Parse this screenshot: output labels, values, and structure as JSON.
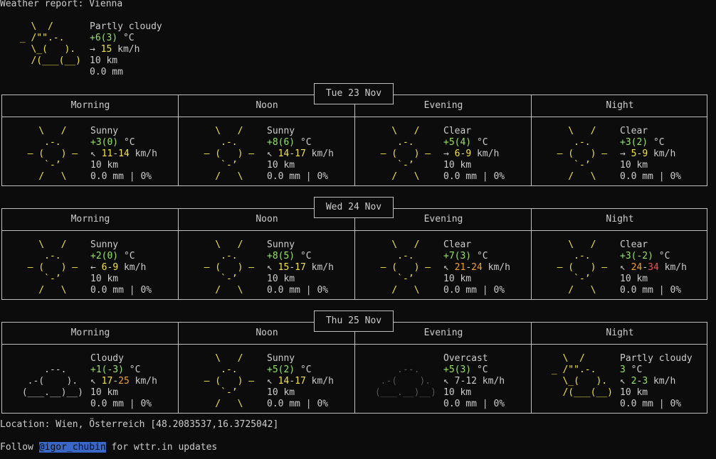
{
  "header": {
    "title": "Weather report: Vienna"
  },
  "current": {
    "art": "   \\  /\n _ /\"\".-.\n   \\_(   ).\n   /(___(__)",
    "condition": "Partly cloudy",
    "temp_main": "+6",
    "temp_paren": "(3)",
    "temp_unit": " °C",
    "wind_dir": "→ ",
    "wind_speed": "15",
    "wind_unit": " km/h",
    "visibility": "10 km",
    "precip": "0.0 mm"
  },
  "days": [
    {
      "date": "Tue 23 Nov",
      "periods": [
        {
          "label": "Morning",
          "art_type": "sun",
          "art": "    \\   /\n     .-.\n  ― (   ) ―\n     `-’\n    /   \\",
          "condition": "Sunny",
          "temp_main": "+3",
          "temp_paren": "(0)",
          "temp_unit": " °C",
          "temp_color": "#99e06a",
          "wind_dir": "↖ ",
          "wind_low": "11",
          "wind_high": "14",
          "wind_low_color": "#f2e14a",
          "wind_high_color": "#f2e14a",
          "wind_unit": " km/h",
          "visibility": "10 km",
          "precip": "0.0 mm | 0%"
        },
        {
          "label": "Noon",
          "art_type": "sun",
          "art": "    \\   /\n     .-.\n  ― (   ) ―\n     `-’\n    /   \\",
          "condition": "Sunny",
          "temp_main": "+8",
          "temp_paren": "(6)",
          "temp_unit": " °C",
          "temp_color": "#99e06a",
          "wind_dir": "↖ ",
          "wind_low": "14",
          "wind_high": "17",
          "wind_low_color": "#f2e14a",
          "wind_high_color": "#f2e14a",
          "wind_unit": " km/h",
          "visibility": "10 km",
          "precip": "0.0 mm | 0%"
        },
        {
          "label": "Evening",
          "art_type": "sun",
          "art": "    \\   /\n     .-.\n  ― (   ) ―\n     `-’\n    /   \\",
          "condition": "Clear",
          "temp_main": "+5",
          "temp_paren": "(4)",
          "temp_unit": " °C",
          "temp_color": "#99e06a",
          "wind_dir": "→ ",
          "wind_low": "6",
          "wind_high": "9",
          "wind_low_color": "#f2e14a",
          "wind_high_color": "#f2e14a",
          "wind_unit": " km/h",
          "visibility": "10 km",
          "precip": "0.0 mm | 0%"
        },
        {
          "label": "Night",
          "art_type": "sun",
          "art": "    \\   /\n     .-.\n  ― (   ) ―\n     `-’\n    /   \\",
          "condition": "Clear",
          "temp_main": "+3",
          "temp_paren": "(2)",
          "temp_unit": " °C",
          "temp_color": "#99e06a",
          "wind_dir": "→ ",
          "wind_low": "5",
          "wind_high": "9",
          "wind_low_color": "#f2e14a",
          "wind_high_color": "#f2e14a",
          "wind_unit": " km/h",
          "visibility": "10 km",
          "precip": "0.0 mm | 0%"
        }
      ]
    },
    {
      "date": "Wed 24 Nov",
      "periods": [
        {
          "label": "Morning",
          "art_type": "sun",
          "art": "    \\   /\n     .-.\n  ― (   ) ―\n     `-’\n    /   \\",
          "condition": "Sunny",
          "temp_main": "+2",
          "temp_paren": "(0)",
          "temp_unit": " °C",
          "temp_color": "#99e06a",
          "wind_dir": "← ",
          "wind_low": "6",
          "wind_high": "9",
          "wind_low_color": "#f2e14a",
          "wind_high_color": "#f2e14a",
          "wind_unit": " km/h",
          "visibility": "10 km",
          "precip": "0.0 mm | 0%"
        },
        {
          "label": "Noon",
          "art_type": "sun",
          "art": "    \\   /\n     .-.\n  ― (   ) ―\n     `-’\n    /   \\",
          "condition": "Sunny",
          "temp_main": "+8",
          "temp_paren": "(5)",
          "temp_unit": " °C",
          "temp_color": "#99e06a",
          "wind_dir": "↖ ",
          "wind_low": "15",
          "wind_high": "17",
          "wind_low_color": "#f2e14a",
          "wind_high_color": "#f2e14a",
          "wind_unit": " km/h",
          "visibility": "10 km",
          "precip": "0.0 mm | 0%"
        },
        {
          "label": "Evening",
          "art_type": "sun",
          "art": "    \\   /\n     .-.\n  ― (   ) ―\n     `-’\n    /   \\",
          "condition": "Clear",
          "temp_main": "+7",
          "temp_paren": "(3)",
          "temp_unit": " °C",
          "temp_color": "#99e06a",
          "wind_dir": "↖ ",
          "wind_low": "21",
          "wind_high": "24",
          "wind_low_color": "#f0a030",
          "wind_high_color": "#f0a030",
          "wind_unit": " km/h",
          "visibility": "10 km",
          "precip": "0.0 mm | 0%"
        },
        {
          "label": "Night",
          "art_type": "sun",
          "art": "    \\   /\n     .-.\n  ― (   ) ―\n     `-’\n    /   \\",
          "condition": "Clear",
          "temp_main": "+3",
          "temp_paren": "(-2)",
          "temp_unit": " °C",
          "temp_color": "#99e06a",
          "wind_dir": "↖ ",
          "wind_low": "24",
          "wind_high": "34",
          "wind_low_color": "#f0a030",
          "wind_high_color": "#f05050",
          "wind_unit": " km/h",
          "visibility": "10 km",
          "precip": "0.0 mm | 0%"
        }
      ]
    },
    {
      "date": "Thu 25 Nov",
      "periods": [
        {
          "label": "Morning",
          "art_type": "cloud",
          "art": "\n     .--.\n  .-(    ).\n (___.__)__)",
          "condition": "Cloudy",
          "temp_main": "+1",
          "temp_paren": "(-3)",
          "temp_unit": " °C",
          "temp_color": "#99e06a",
          "wind_dir": "↖ ",
          "wind_low": "17",
          "wind_high": "25",
          "wind_low_color": "#f2e14a",
          "wind_high_color": "#f0a030",
          "wind_unit": " km/h",
          "visibility": "10 km",
          "precip": "0.0 mm | 0%"
        },
        {
          "label": "Noon",
          "art_type": "sun",
          "art": "    \\   /\n     .-.\n  ― (   ) ―\n     `-’\n    /   \\",
          "condition": "Sunny",
          "temp_main": "+5",
          "temp_paren": "(2)",
          "temp_unit": " °C",
          "temp_color": "#99e06a",
          "wind_dir": "↖ ",
          "wind_low": "14",
          "wind_high": "17",
          "wind_low_color": "#f2e14a",
          "wind_high_color": "#f2e14a",
          "wind_unit": " km/h",
          "visibility": "10 km",
          "precip": "0.0 mm | 0%"
        },
        {
          "label": "Evening",
          "art_type": "overcast",
          "art": "\n     .--.\n  .-(    ).\n (___.__)__)",
          "condition": "Overcast",
          "temp_main": "+5",
          "temp_paren": "(3)",
          "temp_unit": " °C",
          "temp_color": "#99e06a",
          "wind_dir": "↖ ",
          "wind_low": "7",
          "wind_high": "12",
          "wind_low_color": "#cccccc",
          "wind_high_color": "#cccccc",
          "wind_unit": " km/h",
          "visibility": "10 km",
          "precip": "0.0 mm | 0%"
        },
        {
          "label": "Night",
          "art_type": "partly",
          "art": "   \\  /\n _ /\"\".-.\n   \\_(   ).\n   /(___(__)",
          "condition": "Partly cloudy",
          "temp_main": "3",
          "temp_paren": "",
          "temp_unit": " °C",
          "temp_color": "#99e06a",
          "wind_dir": "↖ ",
          "wind_low": "2",
          "wind_high": "3",
          "wind_low_color": "#99e06a",
          "wind_high_color": "#99e06a",
          "wind_unit": " km/h",
          "visibility": "10 km",
          "precip": "0.0 mm | 0%"
        }
      ]
    }
  ],
  "footer": {
    "location": "Location: Wien, Österreich [48.2083537,16.3725042]",
    "follow_prefix": "Follow ",
    "handle": "@igor_chubin",
    "follow_suffix": " for wttr.in updates"
  }
}
